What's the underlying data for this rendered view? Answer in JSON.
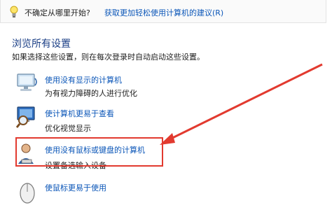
{
  "tip": {
    "text": "不确定从哪里开始?",
    "link": "获取更加轻松使用计算机的建议(R)"
  },
  "section": {
    "title": "浏览所有设置",
    "description": "如果选择这些设置，则在每次登录时自动启动这些设置。"
  },
  "items": [
    {
      "link": "使用没有显示的计算机",
      "subtitle": "为有视力障碍的人进行优化",
      "icon": "narrator-computer-icon"
    },
    {
      "link": "使计算机更易于查看",
      "subtitle": "优化视觉显示",
      "icon": "magnifier-monitor-icon"
    },
    {
      "link": "使用没有鼠标或键盘的计算机",
      "subtitle": "设置备选输入设备",
      "icon": "user-keyboard-icon"
    },
    {
      "link": "使鼠标更易于使用",
      "subtitle": "",
      "icon": "mouse-icon"
    }
  ],
  "colors": {
    "link": "#0b56b8",
    "heading": "#1b3f86",
    "highlight": "#e23a2f"
  }
}
